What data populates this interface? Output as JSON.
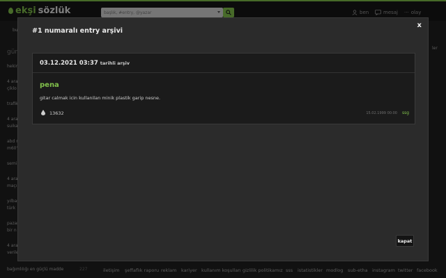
{
  "header": {
    "logo_a": "ekşi",
    "logo_b": "sözlük",
    "search_placeholder": "başlık, #entry, @yazar",
    "nav": [
      {
        "label": "ben",
        "icon": "user-icon"
      },
      {
        "label": "mesaj",
        "icon": "message-icon"
      },
      {
        "label": "olay",
        "icon": "more-icon"
      }
    ]
  },
  "sidebar": {
    "items": [
      "bu",
      "gün",
      "hekim",
      "4 ara",
      "çiklo",
      "trafik",
      "4 ara",
      "suika",
      "abd n",
      "m60'",
      "semi",
      "4 ara",
      "maçı",
      "yılbaş",
      "türk",
      "pazar",
      "bir n",
      "4 ara",
      "verile"
    ],
    "footer_item": "bağımlılığı en güçlü madde",
    "footer_count": "227",
    "right_label": "ler"
  },
  "footer": {
    "links": [
      "iletişim",
      "şeffaflık raporu",
      "reklam",
      "kariyer",
      "kullanım koşulları",
      "gizlilik politikamız",
      "sss",
      "istatistikler",
      "modlog",
      "sub-etha",
      "instagram",
      "twitter",
      "facebook"
    ]
  },
  "modal": {
    "title": "#1 numaralı entry arşivi",
    "close_label": "x",
    "archive_date": "03.12.2021 03:37",
    "archive_suffix": "tarihli arşiv",
    "entry": {
      "title": "pena",
      "body": "gitar calmak icin kullanilan minik plastik garip nesne.",
      "fav_count": "13632",
      "date": "15.02.1999 00:00",
      "author": "ssg"
    },
    "kapat_label": "kapat"
  },
  "colors": {
    "accent": "#81c14b",
    "background": "#1f1f1f",
    "modal": "#2b2b2b"
  }
}
